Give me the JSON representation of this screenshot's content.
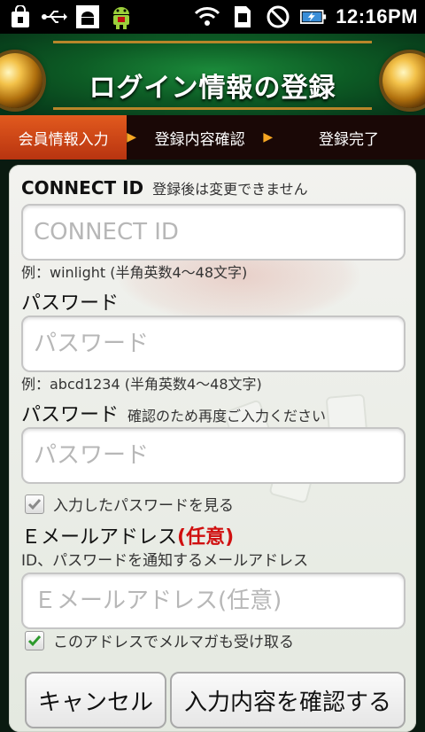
{
  "status_bar": {
    "time": "12:16PM",
    "icons": [
      "bag-icon",
      "usb-icon",
      "android-debug-icon",
      "android-app-icon",
      "wifi-icon",
      "sim-icon",
      "no-sound-icon",
      "battery-charging-icon"
    ]
  },
  "header": {
    "title": "ログイン情報の登録"
  },
  "steps": [
    {
      "label": "会員情報入力",
      "active": true
    },
    {
      "label": "登録内容確認",
      "active": false
    },
    {
      "label": "登録完了",
      "active": false
    }
  ],
  "form": {
    "connect_id": {
      "label": "CONNECT ID",
      "note": "登録後は変更できません",
      "placeholder": "CONNECT ID",
      "example": "例：winlight (半角英数4～48文字)"
    },
    "password": {
      "label": "パスワード",
      "placeholder": "パスワード",
      "example": "例：abcd1234 (半角英数4～48文字)"
    },
    "password_confirm": {
      "label": "パスワード",
      "note": "確認のため再度ご入力ください",
      "placeholder": "パスワード"
    },
    "show_password": {
      "label": "入力したパスワードを見る",
      "checked": true
    },
    "email": {
      "label": "Ｅメールアドレス",
      "optional": "(任意)",
      "note": "ID、パスワードを通知するメールアドレス",
      "placeholder": "Ｅメールアドレス(任意)"
    },
    "newsletter": {
      "label": "このアドレスでメルマガも受け取る",
      "checked": true
    }
  },
  "buttons": {
    "cancel": "キャンセル",
    "confirm": "入力内容を確認する"
  },
  "colors": {
    "accent_orange": "#e25a1e",
    "optional_red": "#d01010",
    "check_green": "#2e9a2e"
  }
}
